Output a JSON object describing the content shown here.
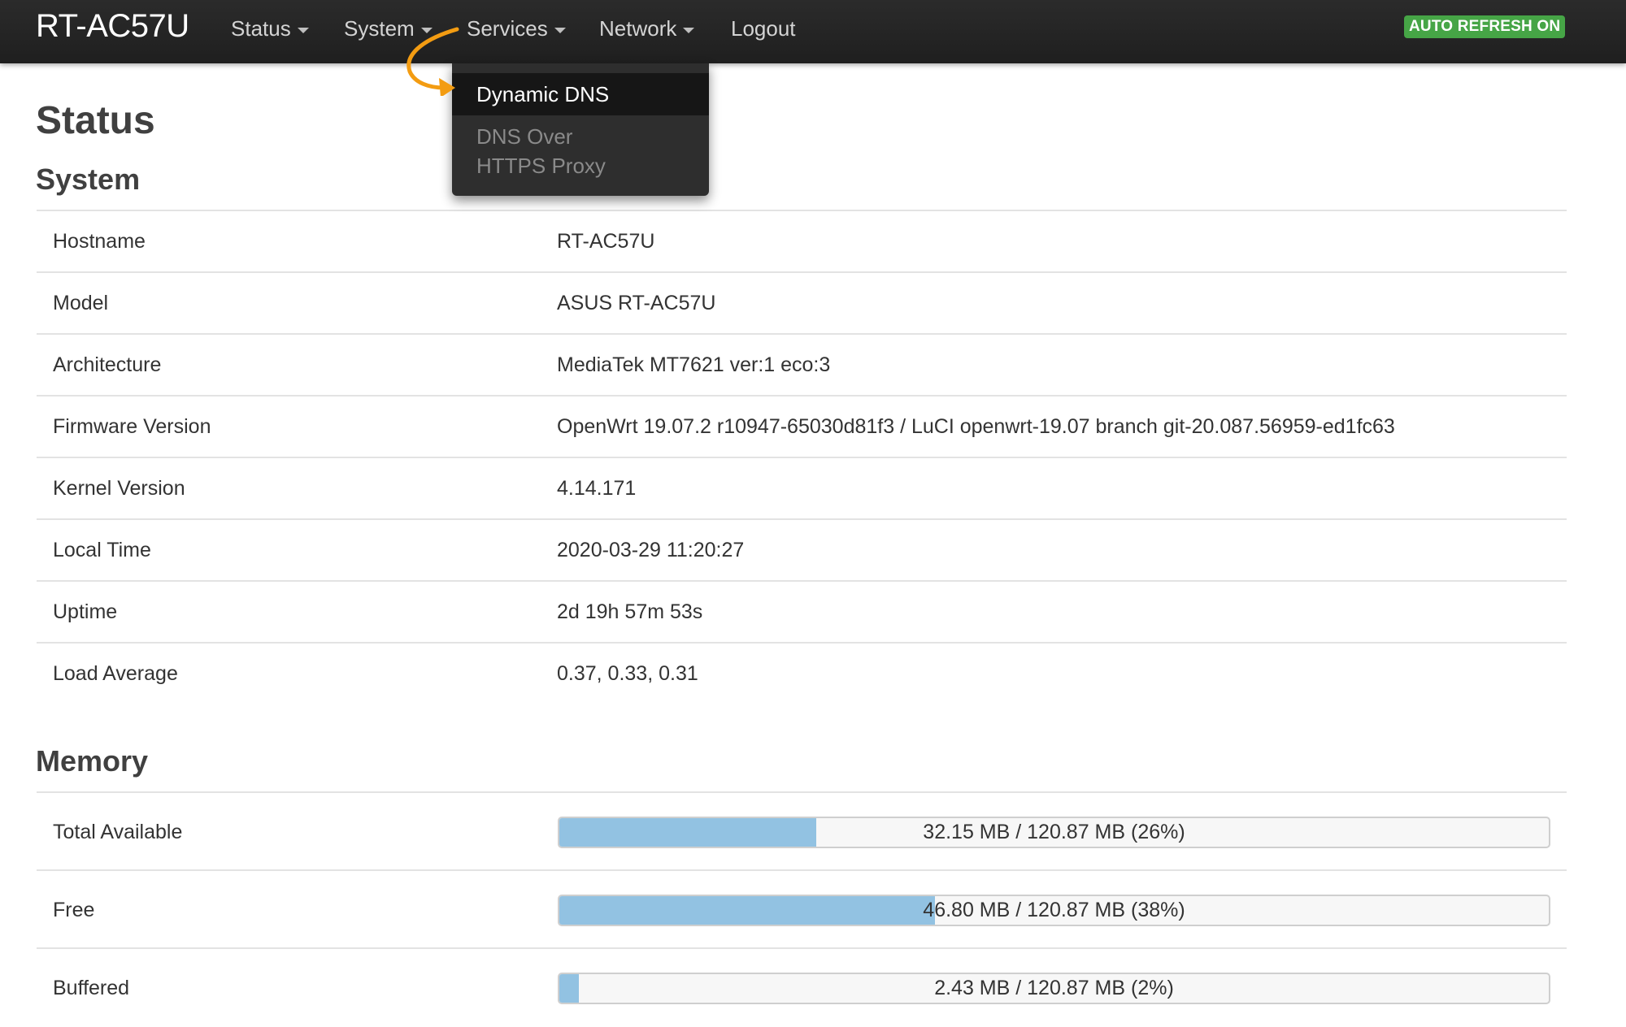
{
  "navbar": {
    "brand": "RT-AC57U",
    "menu": [
      {
        "label": "Status"
      },
      {
        "label": "System"
      },
      {
        "label": "Services"
      },
      {
        "label": "Network"
      },
      {
        "label": "Logout"
      }
    ],
    "auto_refresh": "AUTO REFRESH ON"
  },
  "services_dropdown": {
    "items": [
      {
        "label": "Dynamic DNS",
        "highlighted": true
      },
      {
        "label": "DNS Over HTTPS Proxy"
      }
    ]
  },
  "page_title": "Status",
  "system": {
    "title": "System",
    "rows": [
      {
        "label": "Hostname",
        "value": "RT-AC57U"
      },
      {
        "label": "Model",
        "value": "ASUS RT-AC57U"
      },
      {
        "label": "Architecture",
        "value": "MediaTek MT7621 ver:1 eco:3"
      },
      {
        "label": "Firmware Version",
        "value": "OpenWrt 19.07.2 r10947-65030d81f3 / LuCI openwrt-19.07 branch git-20.087.56959-ed1fc63"
      },
      {
        "label": "Kernel Version",
        "value": "4.14.171"
      },
      {
        "label": "Local Time",
        "value": "2020-03-29 11:20:27"
      },
      {
        "label": "Uptime",
        "value": "2d 19h 57m 53s"
      },
      {
        "label": "Load Average",
        "value": "0.37, 0.33, 0.31"
      }
    ]
  },
  "memory": {
    "title": "Memory",
    "rows": [
      {
        "label": "Total Available",
        "text": "32.15 MB / 120.87 MB (26%)",
        "percent": 26
      },
      {
        "label": "Free",
        "text": "46.80 MB / 120.87 MB (38%)",
        "percent": 38
      },
      {
        "label": "Buffered",
        "text": "2.43 MB / 120.87 MB (2%)",
        "percent": 2
      }
    ]
  },
  "colors": {
    "navbar": "#222222",
    "auto_refresh_badge": "#46a546",
    "progress_fill": "#92c2e2",
    "annotation_arrow": "#f39c12"
  },
  "icons": {
    "menu_caret": "caret-down-icon",
    "annotation": "curved-arrow-icon"
  }
}
